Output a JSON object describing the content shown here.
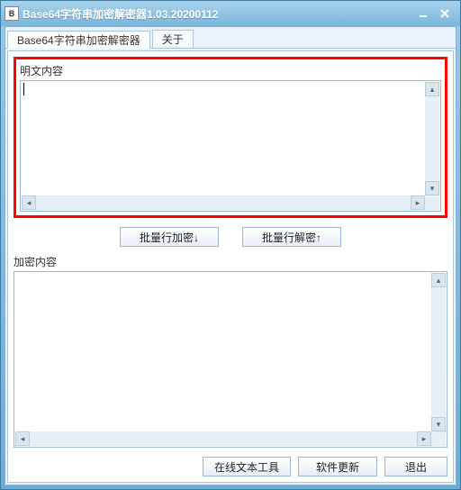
{
  "title": "Base64字符串加密解密器1.03.20200112",
  "tabs": {
    "main": "Base64字符串加密解密器",
    "about": "关于"
  },
  "labels": {
    "plain": "明文内容",
    "cipher": "加密内容"
  },
  "buttons": {
    "encrypt": "批量行加密↓",
    "decrypt": "批量行解密↑",
    "online_tools": "在线文本工具",
    "update": "软件更新",
    "exit": "退出"
  },
  "fields": {
    "plain_value": "",
    "cipher_value": ""
  },
  "colors": {
    "highlight": "#ff0000"
  }
}
